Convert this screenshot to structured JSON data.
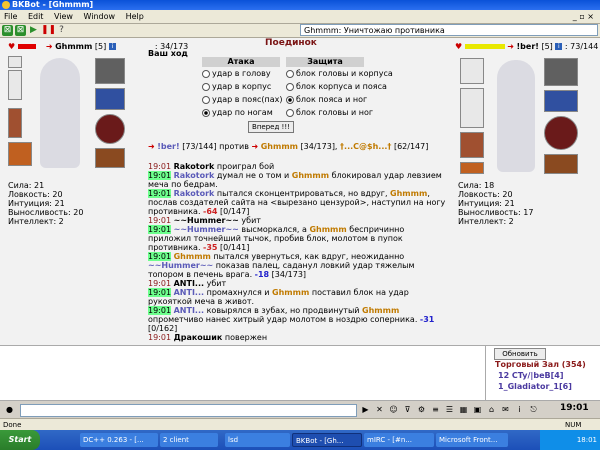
{
  "window": {
    "title": "BKBot - [Ghmmm]"
  },
  "menu": {
    "items": [
      "File",
      "Edit",
      "View",
      "Window",
      "Help"
    ]
  },
  "toolbar": {
    "status_message": "Ghmmm: Уничтожаю противника"
  },
  "battle": {
    "title": "Поединок",
    "your_move": "Ваш ход",
    "player": {
      "name": "Ghmmm",
      "level": "[5]",
      "hp": ": 34/173",
      "level_badge": "i"
    },
    "enemy": {
      "name": "!ber!",
      "level": "[5]",
      "hp": ": 73/144",
      "level_badge": "i"
    },
    "attack_header": "Атака",
    "defense_header": "Защита",
    "attack_options": [
      "удар в голову",
      "удар в корпус",
      "удар в пояс(пах)",
      "удар по ногам"
    ],
    "attack_selected": 3,
    "defense_options": [
      "блок головы и корпуса",
      "блок корпуса и пояса",
      "блок пояса и ног",
      "блок головы и ног"
    ],
    "defense_selected": 2,
    "forward_button": "Вперед !!!",
    "versus": {
      "left_name": "!ber!",
      "left_hp": "[73/144]",
      "word": "против",
      "right_name": "Ghmmm",
      "right_hp": "[34/173],",
      "third": "†...C@$h...†",
      "third_hp": "[62/147]"
    },
    "player_stats": [
      "Сила: 21",
      "Ловкость: 20",
      "Интуиция: 21",
      "Выносливость: 20",
      "Интеллект: 2"
    ],
    "enemy_stats": [
      "Сила: 18",
      "Ловкость: 20",
      "Интуиция: 21",
      "Выносливость: 17",
      "Интеллект: 2"
    ]
  },
  "log": {
    "lines": [
      {
        "time": "19:01",
        "name": "Rakotork",
        "text": " проиграл бой"
      },
      {
        "time": "19:01",
        "name": "Rakotork",
        "text": " думал не о том и ",
        "name2": "Ghmmm",
        "text2": " блокировал удар левзием меча по бедрам."
      },
      {
        "time": "19:01",
        "name": "Rakotork",
        "text": " пытался сконцентрироваться, но вдруг, ",
        "name2": "Ghmmm",
        "text2": ", послав создателей сайта на <вырезано цензурой>, наступил на ногу противника.",
        "dmg": "-64",
        "hp": " [0/147]"
      },
      {
        "time": "19:01",
        "name": "~~Hummer~~",
        "text": " убит"
      },
      {
        "time": "19:01",
        "name": "~~Hummer~~",
        "text": " высморкался, а ",
        "name2": "Ghmmm",
        "text2": " беспричинно приложил точнейший тычок, пробив блок, молотом в пупок противника.",
        "dmg": "-35",
        "hp": " [0/141]"
      },
      {
        "time": "19:01",
        "name": "Ghmmm",
        "text": " пытался увернуться, как вдруг, неожиданно ",
        "name2": "~~Hummer~~",
        "text2": " показав палец, саданул ловкий удар тяжелым топором в печень врага.",
        "dmg": "-18",
        "hp": " [34/173]"
      },
      {
        "time": "19:01",
        "name": "ANTI...",
        "text": " убит"
      },
      {
        "time": "19:01",
        "name": "ANTI...",
        "text": " промахнулся и ",
        "name2": "Ghmmm",
        "text2": " поставил блок на удар рукояткой меча в живот."
      },
      {
        "time": "19:01",
        "name": "ANTI...",
        "text": " ковырялся в зубах, но продвинутый ",
        "name2": "Ghmmm",
        "text2": " опрометчиво нанес хитрый удар молотом в ноздрю соперника.",
        "dmg": "-31",
        "hp": " [0/162]"
      },
      {
        "time": "19:01",
        "name": "Дракошик",
        "text": " повержен"
      }
    ]
  },
  "trade": {
    "update_button": "Обновить",
    "title": "Торговый Зал (354)",
    "rows": [
      "12 CTy/|beB[4]",
      "1_Gladiator_1[6]"
    ]
  },
  "clock": "19:01",
  "statusbar": {
    "left": "Done",
    "right": "NUM"
  },
  "taskbar": {
    "start": "Start",
    "tasks": [
      "DC++ 0.263 - [...",
      "2 client",
      "lsd",
      "BKBot - [Gh...",
      "mIRC - [#n...",
      "Microsoft Front..."
    ],
    "tray_time": "18:01"
  },
  "colors": {
    "title_bar": "#0a52d8",
    "battle_title": "#7a1414",
    "highlight_time": "#6dff8d",
    "player_name": "#c07a00"
  }
}
